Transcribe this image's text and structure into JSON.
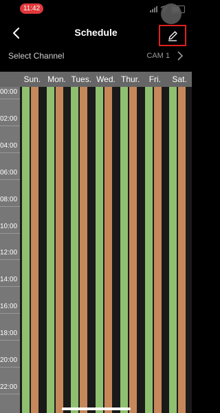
{
  "status": {
    "time": "11:42"
  },
  "nav": {
    "title": "Schedule"
  },
  "channel": {
    "label": "Select Channel",
    "value": "CAM 1"
  },
  "days": [
    "Sun.",
    "Mon.",
    "Tues.",
    "Wed.",
    "Thur.",
    "Fri.",
    "Sat."
  ],
  "hours": [
    "00:00",
    "02:00",
    "04:00",
    "06:00",
    "08:00",
    "10:00",
    "12:00",
    "14:00",
    "16:00",
    "18:00",
    "20:00",
    "22:00"
  ],
  "colors": {
    "stripe_green": "#8fc070",
    "stripe_orange": "#c6885a",
    "highlight": "#e02020"
  }
}
